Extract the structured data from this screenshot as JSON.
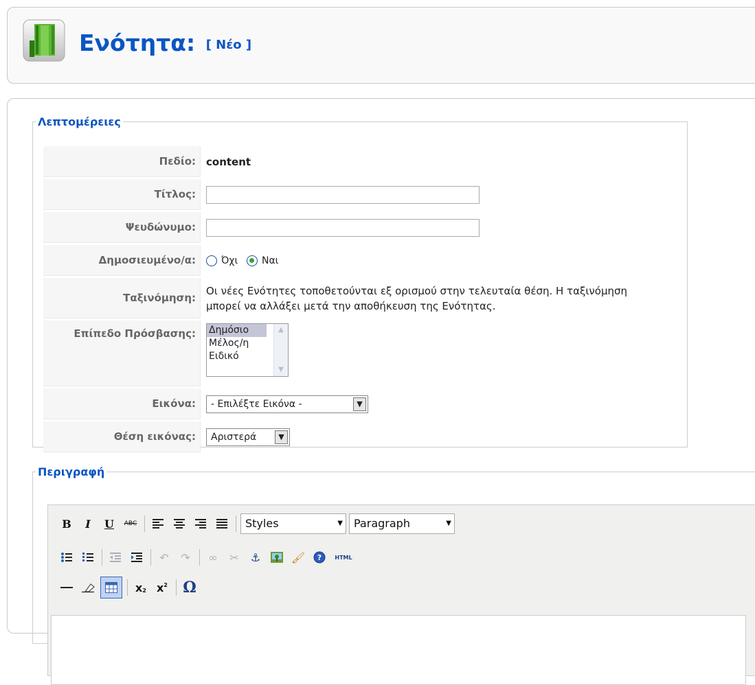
{
  "header": {
    "title": "Ενότητα:",
    "subtitle": "[ Νέο ]",
    "icon": "section-icon"
  },
  "details": {
    "legend": "Λεπτομέρειες",
    "field": {
      "label": "Πεδίο:",
      "value": "content"
    },
    "title": {
      "label": "Τίτλος:",
      "value": ""
    },
    "alias": {
      "label": "Ψευδώνυμο:",
      "value": ""
    },
    "published": {
      "label": "Δημοσιευμένο/α:",
      "options": [
        "Όχι",
        "Ναι"
      ],
      "selected": "Ναι"
    },
    "ordering": {
      "label": "Ταξινόμηση:",
      "note": "Οι νέες Ενότητες τοποθετούνται εξ ορισμού στην τελευταία θέση. Η ταξινόμηση μπορεί να αλλάξει μετά την αποθήκευση της Ενότητας."
    },
    "access": {
      "label": "Επίπεδο Πρόσβασης:",
      "options": [
        "Δημόσιο",
        "Μέλος/η",
        "Ειδικό"
      ],
      "selected": "Δημόσιο"
    },
    "image": {
      "label": "Εικόνα:",
      "value": "- Επιλέξτε Εικόνα -"
    },
    "image_position": {
      "label": "Θέση εικόνας:",
      "value": "Αριστερά"
    }
  },
  "description": {
    "legend": "Περιγραφή",
    "toolbar": {
      "styles": "Styles",
      "format": "Paragraph",
      "html_label": "HTML",
      "row1_icons": [
        "bold-icon",
        "italic-icon",
        "underline-icon",
        "strikethrough-icon",
        "align-left-icon",
        "align-center-icon",
        "align-right-icon",
        "align-justify-icon"
      ],
      "row2_icons": [
        "bullet-list-icon",
        "numbered-list-icon",
        "outdent-icon",
        "indent-icon",
        "undo-icon",
        "redo-icon",
        "link-icon",
        "unlink-icon",
        "anchor-icon",
        "image-icon",
        "cleanup-icon",
        "help-icon",
        "html-icon"
      ],
      "row3_icons": [
        "horizontal-rule-icon",
        "remove-format-icon",
        "table-icon",
        "subscript-icon",
        "superscript-icon",
        "special-char-icon"
      ]
    }
  }
}
